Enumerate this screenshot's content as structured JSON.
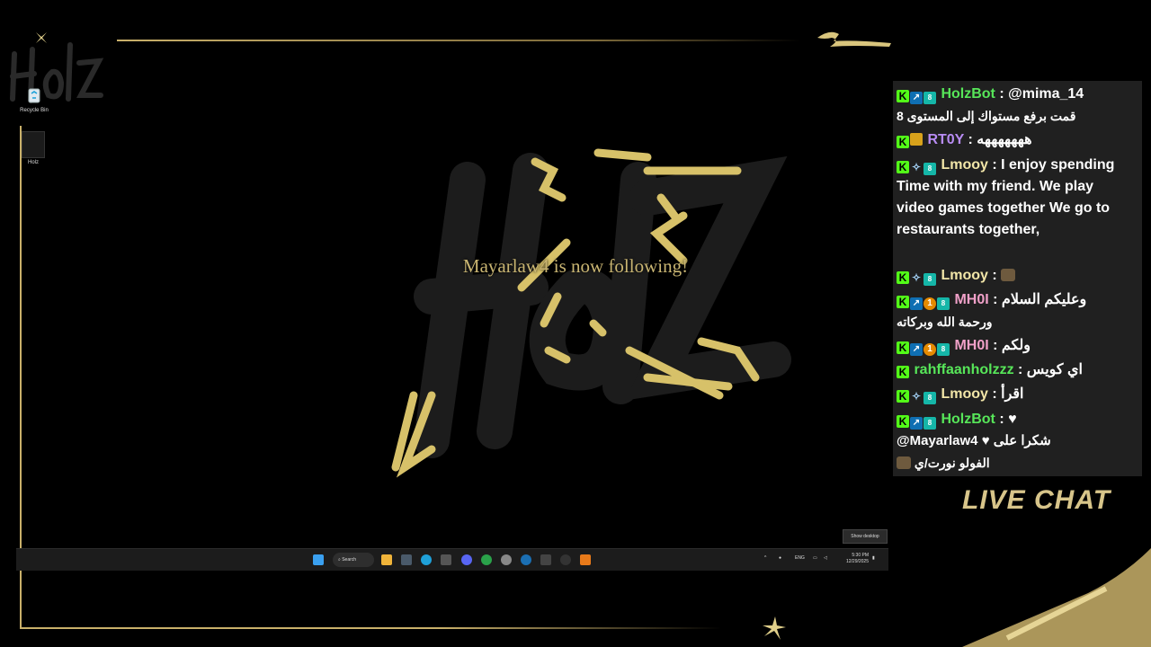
{
  "overlay": {
    "corner_logo": "Holz",
    "follow_alert": "Mayarlaw4 is now following!",
    "live_chat_label": "LIVE CHAT"
  },
  "desktop": {
    "icons": [
      {
        "label": "Recycle Bin",
        "icon": "recycle-bin-icon"
      },
      {
        "label": "Holz",
        "icon": "holz-shortcut-icon"
      }
    ],
    "show_desktop_tooltip": "Show desktop"
  },
  "taskbar": {
    "search_label": "Search",
    "language": "ENG",
    "time": "5:30 PM",
    "date": "12/29/2025",
    "apps": [
      "start-icon",
      "search-icon",
      "file-explorer-icon",
      "store-icon",
      "edge-icon",
      "taskview-icon",
      "discord-icon",
      "chrome-icon",
      "settings-icon",
      "steam-icon",
      "obs-icon",
      "keyboard-icon",
      "app-icon",
      "vlc-icon"
    ]
  },
  "chat": {
    "messages": [
      {
        "user": "HolzBot",
        "user_color": "#57e659",
        "text": "@mima_14",
        "line2": "قمت برفع مستواك إلى المستوى 8"
      },
      {
        "user": "RT0Y",
        "user_color": "#b88cf4",
        "text": "هههههههه"
      },
      {
        "user": "Lmooy",
        "user_color": "#f2e6a8",
        "text": "I enjoy spending Time with my friend. We play video games together We go to restaurants together,"
      },
      {
        "user": "Lmooy",
        "user_color": "#f2e6a8",
        "text": ""
      },
      {
        "user": "MH0I",
        "user_color": "#f0a0c8",
        "text": "وعليكم السلام",
        "line2": "ورحمة الله وبركاته"
      },
      {
        "user": "MH0I",
        "user_color": "#f0a0c8",
        "text": "ولكم"
      },
      {
        "user": "rahffaanholzzz",
        "user_color": "#57e659",
        "text": "اي كويس"
      },
      {
        "user": "Lmooy",
        "user_color": "#f2e6a8",
        "text": "اقرأ"
      },
      {
        "user": "HolzBot",
        "user_color": "#57e659",
        "text": "",
        "line2": "شكرا على",
        "line2b": "@Mayarlaw4",
        "line3": "الفولو نورت/ي"
      }
    ]
  }
}
